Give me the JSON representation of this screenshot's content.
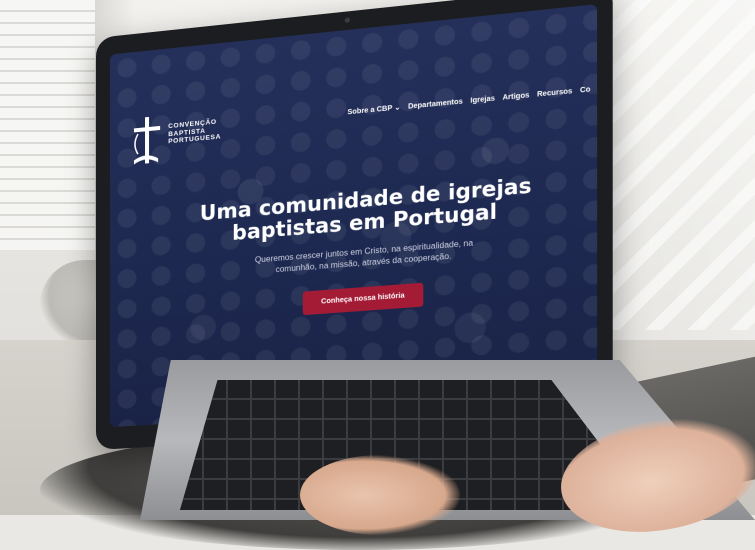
{
  "site": {
    "logo_lines": [
      "Convenção",
      "Baptista",
      "Portuguesa"
    ],
    "nav": [
      "Sobre a CBP ⌄",
      "Departamentos",
      "Igrejas",
      "Artigos",
      "Recursos",
      "Co"
    ]
  },
  "hero": {
    "title_line1": "Uma comunidade de igrejas",
    "title_line2": "baptistas em Portugal",
    "subtitle": "Queremos crescer juntos em Cristo, na espiritualidade, na comunhão, na missão, através da cooperação.",
    "cta_label": "Conheça nossa história"
  },
  "colors": {
    "hero_bg": "#1d2850",
    "cta": "#a41b35",
    "text": "#ffffff"
  }
}
